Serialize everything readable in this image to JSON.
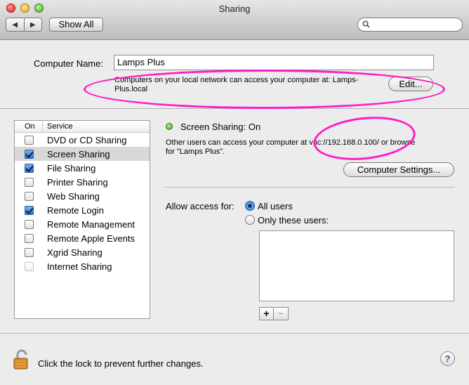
{
  "window": {
    "title": "Sharing"
  },
  "toolbar": {
    "back_icon": "◀",
    "forward_icon": "▶",
    "show_all_label": "Show All",
    "search_value": ""
  },
  "computer_name": {
    "label": "Computer Name:",
    "value": "Lamps Plus",
    "info_line1": "Computers on your local network can access your computer at: Lamps-",
    "info_line2": "Plus.local",
    "edit_label": "Edit..."
  },
  "services": {
    "header_on": "On",
    "header_service": "Service",
    "items": [
      {
        "label": "DVD or CD Sharing",
        "checked": false,
        "selected": false,
        "disabled": false
      },
      {
        "label": "Screen Sharing",
        "checked": true,
        "selected": true,
        "disabled": false
      },
      {
        "label": "File Sharing",
        "checked": true,
        "selected": false,
        "disabled": false
      },
      {
        "label": "Printer Sharing",
        "checked": false,
        "selected": false,
        "disabled": false
      },
      {
        "label": "Web Sharing",
        "checked": false,
        "selected": false,
        "disabled": false
      },
      {
        "label": "Remote Login",
        "checked": true,
        "selected": false,
        "disabled": false
      },
      {
        "label": "Remote Management",
        "checked": false,
        "selected": false,
        "disabled": false
      },
      {
        "label": "Remote Apple Events",
        "checked": false,
        "selected": false,
        "disabled": false
      },
      {
        "label": "Xgrid Sharing",
        "checked": false,
        "selected": false,
        "disabled": false
      },
      {
        "label": "Internet Sharing",
        "checked": false,
        "selected": false,
        "disabled": true
      }
    ]
  },
  "detail": {
    "status": "Screen Sharing: On",
    "info_line1": "Other users can access your computer at vnc://192.168.0.100/ or browse",
    "info_line2": "for \"Lamps Plus\".",
    "computer_settings_label": "Computer Settings...",
    "allow_label": "Allow access for:",
    "option_all": "All users",
    "option_only": "Only these users:",
    "plus_label": "+",
    "minus_label": "−"
  },
  "footer": {
    "lock_text": "Click the lock to prevent further changes.",
    "help_label": "?"
  },
  "colors": {
    "highlight": "#ff1cc8",
    "accent": "#2f72d1"
  }
}
